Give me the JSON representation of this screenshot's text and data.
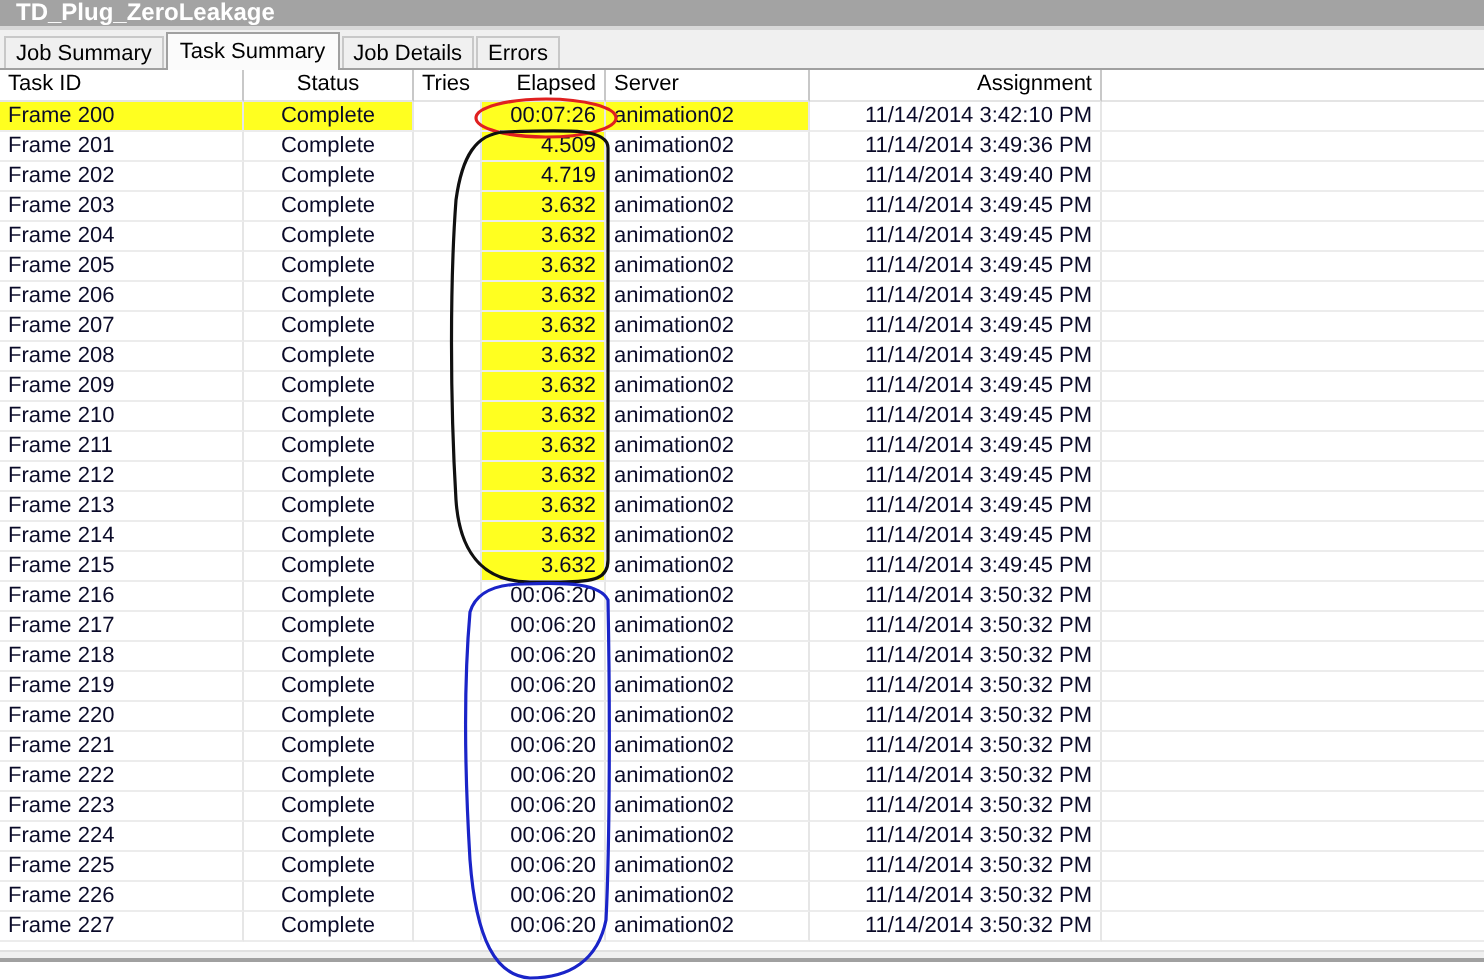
{
  "window": {
    "title": "TD_Plug_ZeroLeakage"
  },
  "tabs": [
    {
      "label": "Job Summary",
      "selected": false
    },
    {
      "label": "Task Summary",
      "selected": true
    },
    {
      "label": "Job Details",
      "selected": false
    },
    {
      "label": "Errors",
      "selected": false
    }
  ],
  "table": {
    "columns": [
      "Task ID",
      "Status",
      "Tries",
      "Elapsed",
      "Server",
      "Assignment"
    ],
    "rows": [
      {
        "task_id": "Frame 200",
        "status": "Complete",
        "elapsed": "00:07:26",
        "server": "animation02",
        "assignment": "11/14/2014 3:42:10 PM",
        "row_highlighted": true,
        "highlighted": true
      },
      {
        "task_id": "Frame 201",
        "status": "Complete",
        "elapsed": "4.509",
        "server": "animation02",
        "assignment": "11/14/2014 3:49:36 PM",
        "row_highlighted": false,
        "highlighted": true
      },
      {
        "task_id": "Frame 202",
        "status": "Complete",
        "elapsed": "4.719",
        "server": "animation02",
        "assignment": "11/14/2014 3:49:40 PM",
        "row_highlighted": false,
        "highlighted": true
      },
      {
        "task_id": "Frame 203",
        "status": "Complete",
        "elapsed": "3.632",
        "server": "animation02",
        "assignment": "11/14/2014 3:49:45 PM",
        "row_highlighted": false,
        "highlighted": true
      },
      {
        "task_id": "Frame 204",
        "status": "Complete",
        "elapsed": "3.632",
        "server": "animation02",
        "assignment": "11/14/2014 3:49:45 PM",
        "row_highlighted": false,
        "highlighted": true
      },
      {
        "task_id": "Frame 205",
        "status": "Complete",
        "elapsed": "3.632",
        "server": "animation02",
        "assignment": "11/14/2014 3:49:45 PM",
        "row_highlighted": false,
        "highlighted": true
      },
      {
        "task_id": "Frame 206",
        "status": "Complete",
        "elapsed": "3.632",
        "server": "animation02",
        "assignment": "11/14/2014 3:49:45 PM",
        "row_highlighted": false,
        "highlighted": true
      },
      {
        "task_id": "Frame 207",
        "status": "Complete",
        "elapsed": "3.632",
        "server": "animation02",
        "assignment": "11/14/2014 3:49:45 PM",
        "row_highlighted": false,
        "highlighted": true
      },
      {
        "task_id": "Frame 208",
        "status": "Complete",
        "elapsed": "3.632",
        "server": "animation02",
        "assignment": "11/14/2014 3:49:45 PM",
        "row_highlighted": false,
        "highlighted": true
      },
      {
        "task_id": "Frame 209",
        "status": "Complete",
        "elapsed": "3.632",
        "server": "animation02",
        "assignment": "11/14/2014 3:49:45 PM",
        "row_highlighted": false,
        "highlighted": true
      },
      {
        "task_id": "Frame 210",
        "status": "Complete",
        "elapsed": "3.632",
        "server": "animation02",
        "assignment": "11/14/2014 3:49:45 PM",
        "row_highlighted": false,
        "highlighted": true
      },
      {
        "task_id": "Frame 211",
        "status": "Complete",
        "elapsed": "3.632",
        "server": "animation02",
        "assignment": "11/14/2014 3:49:45 PM",
        "row_highlighted": false,
        "highlighted": true
      },
      {
        "task_id": "Frame 212",
        "status": "Complete",
        "elapsed": "3.632",
        "server": "animation02",
        "assignment": "11/14/2014 3:49:45 PM",
        "row_highlighted": false,
        "highlighted": true
      },
      {
        "task_id": "Frame 213",
        "status": "Complete",
        "elapsed": "3.632",
        "server": "animation02",
        "assignment": "11/14/2014 3:49:45 PM",
        "row_highlighted": false,
        "highlighted": true
      },
      {
        "task_id": "Frame 214",
        "status": "Complete",
        "elapsed": "3.632",
        "server": "animation02",
        "assignment": "11/14/2014 3:49:45 PM",
        "row_highlighted": false,
        "highlighted": true
      },
      {
        "task_id": "Frame 215",
        "status": "Complete",
        "elapsed": "3.632",
        "server": "animation02",
        "assignment": "11/14/2014 3:49:45 PM",
        "row_highlighted": false,
        "highlighted": true
      },
      {
        "task_id": "Frame 216",
        "status": "Complete",
        "elapsed": "00:06:20",
        "server": "animation02",
        "assignment": "11/14/2014 3:50:32 PM",
        "row_highlighted": false,
        "highlighted": false
      },
      {
        "task_id": "Frame 217",
        "status": "Complete",
        "elapsed": "00:06:20",
        "server": "animation02",
        "assignment": "11/14/2014 3:50:32 PM",
        "row_highlighted": false,
        "highlighted": false
      },
      {
        "task_id": "Frame 218",
        "status": "Complete",
        "elapsed": "00:06:20",
        "server": "animation02",
        "assignment": "11/14/2014 3:50:32 PM",
        "row_highlighted": false,
        "highlighted": false
      },
      {
        "task_id": "Frame 219",
        "status": "Complete",
        "elapsed": "00:06:20",
        "server": "animation02",
        "assignment": "11/14/2014 3:50:32 PM",
        "row_highlighted": false,
        "highlighted": false
      },
      {
        "task_id": "Frame 220",
        "status": "Complete",
        "elapsed": "00:06:20",
        "server": "animation02",
        "assignment": "11/14/2014 3:50:32 PM",
        "row_highlighted": false,
        "highlighted": false
      },
      {
        "task_id": "Frame 221",
        "status": "Complete",
        "elapsed": "00:06:20",
        "server": "animation02",
        "assignment": "11/14/2014 3:50:32 PM",
        "row_highlighted": false,
        "highlighted": false
      },
      {
        "task_id": "Frame 222",
        "status": "Complete",
        "elapsed": "00:06:20",
        "server": "animation02",
        "assignment": "11/14/2014 3:50:32 PM",
        "row_highlighted": false,
        "highlighted": false
      },
      {
        "task_id": "Frame 223",
        "status": "Complete",
        "elapsed": "00:06:20",
        "server": "animation02",
        "assignment": "11/14/2014 3:50:32 PM",
        "row_highlighted": false,
        "highlighted": false
      },
      {
        "task_id": "Frame 224",
        "status": "Complete",
        "elapsed": "00:06:20",
        "server": "animation02",
        "assignment": "11/14/2014 3:50:32 PM",
        "row_highlighted": false,
        "highlighted": false
      },
      {
        "task_id": "Frame 225",
        "status": "Complete",
        "elapsed": "00:06:20",
        "server": "animation02",
        "assignment": "11/14/2014 3:50:32 PM",
        "row_highlighted": false,
        "highlighted": false
      },
      {
        "task_id": "Frame 226",
        "status": "Complete",
        "elapsed": "00:06:20",
        "server": "animation02",
        "assignment": "11/14/2014 3:50:32 PM",
        "row_highlighted": false,
        "highlighted": false
      },
      {
        "task_id": "Frame 227",
        "status": "Complete",
        "elapsed": "00:06:20",
        "server": "animation02",
        "assignment": "11/14/2014 3:50:32 PM",
        "row_highlighted": false,
        "highlighted": false
      }
    ]
  }
}
